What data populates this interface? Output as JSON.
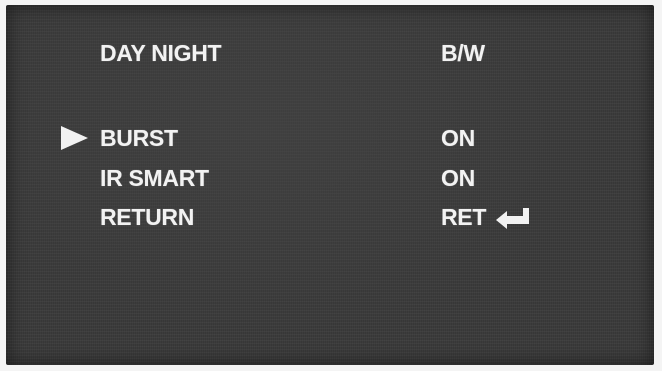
{
  "menu": {
    "header": {
      "label": "DAY NIGHT",
      "value": "B/W"
    },
    "items": [
      {
        "label": "BURST",
        "value": "ON",
        "selected": true
      },
      {
        "label": "IR SMART",
        "value": "ON",
        "selected": false
      },
      {
        "label": "RETURN",
        "value": "RET",
        "selected": false,
        "icon": "enter-return-icon"
      }
    ],
    "cursor_icon": "triangle-right-cursor-icon",
    "colors": {
      "background": "#3a3a3a",
      "text": "#f2f2f2",
      "frame": "#f4f4f4"
    }
  }
}
